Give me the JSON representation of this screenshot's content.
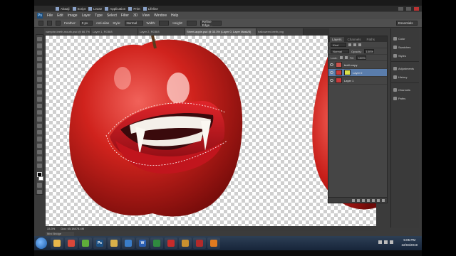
{
  "bookmarks": [
    {
      "label": "Abaaji"
    },
    {
      "label": "Script"
    },
    {
      "label": "Lease"
    },
    {
      "label": "Application"
    },
    {
      "label": "Print"
    },
    {
      "label": "Lifeline"
    }
  ],
  "menu": [
    "File",
    "Edit",
    "Image",
    "Layer",
    "Type",
    "Select",
    "Filter",
    "3D",
    "View",
    "Window",
    "Help"
  ],
  "options": {
    "feather_label": "Feather:",
    "feather_value": "0 px",
    "antialias_label": "Anti-alias",
    "style_label": "Style:",
    "style_value": "Normal",
    "width_label": "Width:",
    "height_label": "Height:",
    "refine_label": "Refine Edge...",
    "workspace": "Essentials"
  },
  "doc_tabs": [
    {
      "label": "vampire-teeth-mouth.psd @ 66.7%",
      "active": false
    },
    {
      "label": "Layer 1, RGB/8",
      "active": false
    },
    {
      "label": "Layer 2, RGB/8",
      "active": false
    },
    {
      "label": "Street-apple.psd @ 33.3% (Layer 0, Layer Mask/8)",
      "active": true
    },
    {
      "label": "halloween-teeth.png",
      "active": false
    }
  ],
  "status": {
    "zoom": "33.3%",
    "doc": "Doc: 65.1M/78.4M",
    "mini_bridge": "Mini Bridge"
  },
  "layers_panel": {
    "tabs": [
      "Layers",
      "Channels",
      "Paths"
    ],
    "kind_label": "Kind",
    "blend_mode": "Normal",
    "opacity_label": "Opacity:",
    "opacity_value": "100%",
    "lock_label": "Lock:",
    "fill_label": "Fill:",
    "fill_value": "100%",
    "layers": [
      {
        "name": "teeth copy",
        "selected": false,
        "thumb_color": "#c9524c"
      },
      {
        "name": "Layer 0",
        "selected": true,
        "thumb_color": "#d9e04a"
      },
      {
        "name": "Layer 1",
        "selected": false,
        "thumb_color": "#c93a3a"
      }
    ]
  },
  "dock": {
    "group1": [
      "Color",
      "Swatches",
      "Styles"
    ],
    "group2": [
      "Adjustments",
      "History"
    ],
    "group3": [
      "Channels",
      "Paths"
    ]
  },
  "taskbar": {
    "apps": [
      {
        "name": "explorer",
        "glyph": "",
        "color": "#e8b64a"
      },
      {
        "name": "chrome",
        "glyph": "",
        "color": "#d9473a"
      },
      {
        "name": "utorrent",
        "glyph": "",
        "color": "#5fae3a"
      },
      {
        "name": "photoshop",
        "glyph": "Ps",
        "color": "#1b4f82"
      },
      {
        "name": "folder",
        "glyph": "",
        "color": "#d8b04a"
      },
      {
        "name": "media",
        "glyph": "",
        "color": "#3a7dc9"
      },
      {
        "name": "word",
        "glyph": "W",
        "color": "#2b5fb3"
      },
      {
        "name": "excel",
        "glyph": "",
        "color": "#2f8a3f"
      },
      {
        "name": "pdf",
        "glyph": "",
        "color": "#c62b2b"
      },
      {
        "name": "photos",
        "glyph": "",
        "color": "#c9902f"
      },
      {
        "name": "acrobat",
        "glyph": "",
        "color": "#b22a2a"
      },
      {
        "name": "vlc",
        "glyph": "",
        "color": "#e07a1f"
      }
    ],
    "time": "5:05 PM",
    "date": "22/03/2019"
  },
  "colors": {
    "apple_red": "#c8201c",
    "selection_highlight": "#5a7dac",
    "panel_bg": "#454545"
  }
}
